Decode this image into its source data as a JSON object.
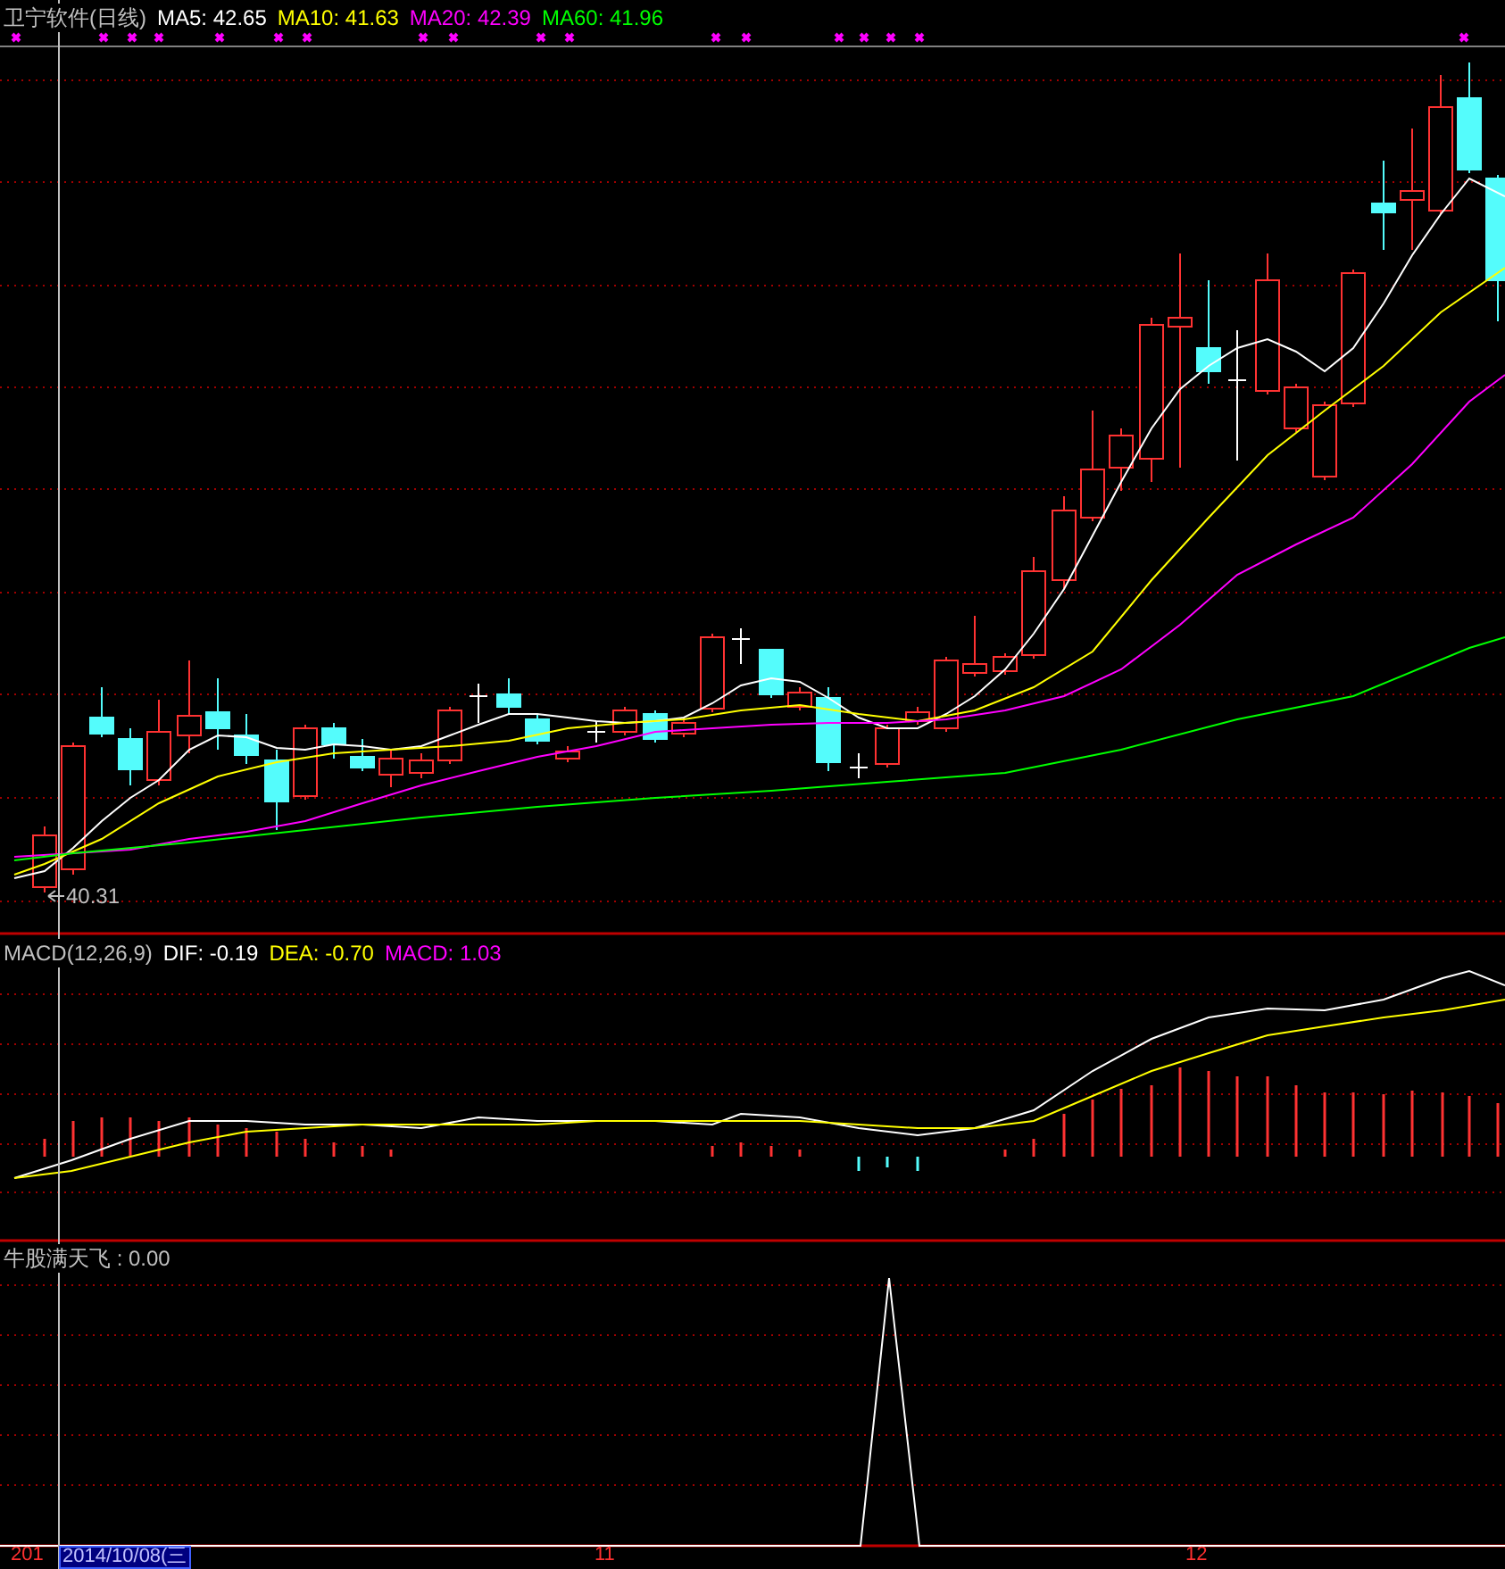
{
  "main_panel": {
    "title": "卫宁软件(日线)",
    "averages": [
      {
        "label": "MA5: 42.65",
        "color": "#ffffff"
      },
      {
        "label": "MA10: 41.63",
        "color": "#ffff00"
      },
      {
        "label": "MA20: 42.39",
        "color": "#ff00ff"
      },
      {
        "label": "MA60: 41.96",
        "color": "#00ff00"
      }
    ],
    "low_marker": "40.31"
  },
  "macd_panel": {
    "title": "MACD(12,26,9)",
    "values": [
      {
        "label": "DIF: -0.19",
        "color": "#ffffff"
      },
      {
        "label": "DEA: -0.70",
        "color": "#ffff00"
      },
      {
        "label": "MACD: 1.03",
        "color": "#ff00ff"
      }
    ]
  },
  "indicator_panel": {
    "label": "牛股满天飞 : 0.00"
  },
  "x_axis": {
    "labels": [
      {
        "text": "201",
        "selected": false
      },
      {
        "text": "2014/10/08(三",
        "selected": true
      },
      {
        "text": "11",
        "selected": false
      },
      {
        "text": "12",
        "selected": false
      }
    ]
  }
}
